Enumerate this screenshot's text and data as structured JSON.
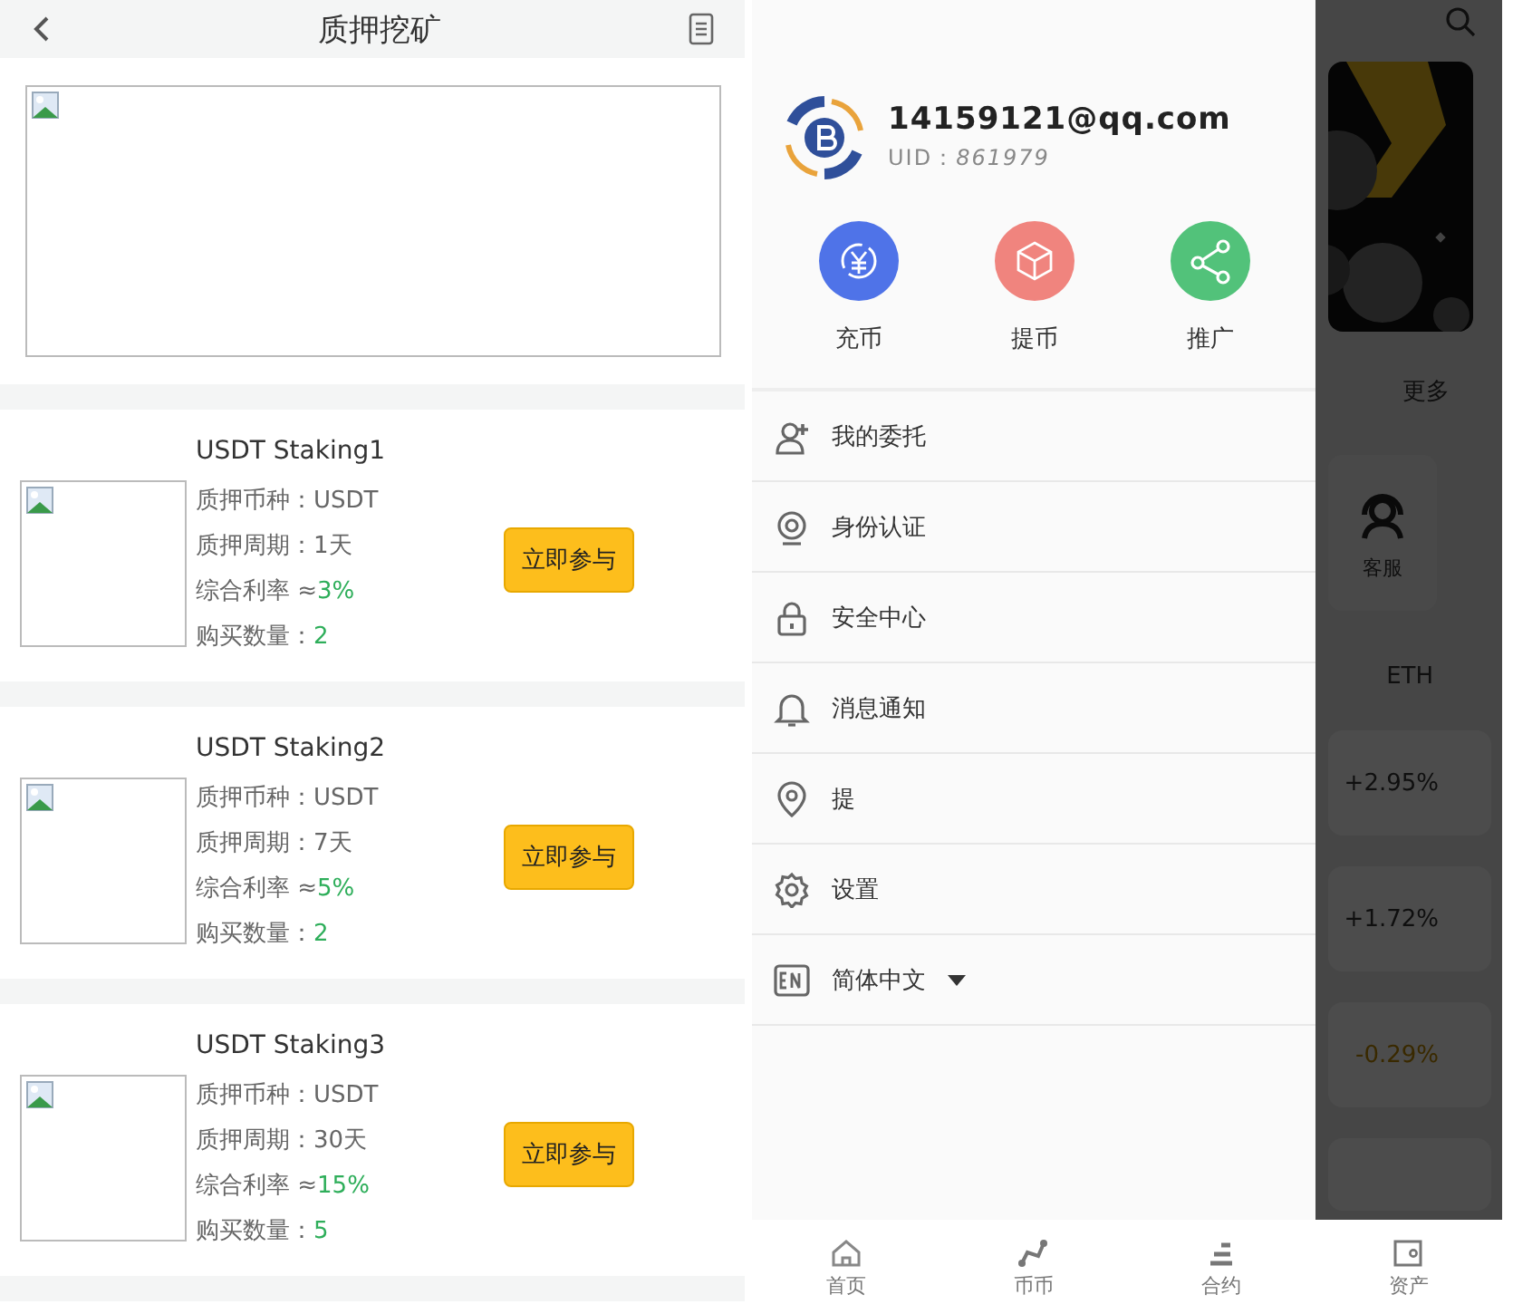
{
  "staking_page": {
    "title": "质押挖矿",
    "products": [
      {
        "name": "USDT Staking1",
        "rows": [
          {
            "label": "质押币种：",
            "value": "USDT",
            "kind": "plain"
          },
          {
            "label": "质押周期：",
            "value": "1天",
            "kind": "plain"
          },
          {
            "label": "综合利率 ≈",
            "value": "3%",
            "kind": "highlight"
          },
          {
            "label": "购买数量：",
            "value": "2",
            "kind": "highlight"
          }
        ],
        "button": "立即参与"
      },
      {
        "name": "USDT Staking2",
        "rows": [
          {
            "label": "质押币种：",
            "value": "USDT",
            "kind": "plain"
          },
          {
            "label": "质押周期：",
            "value": "7天",
            "kind": "plain"
          },
          {
            "label": "综合利率 ≈",
            "value": "5%",
            "kind": "highlight"
          },
          {
            "label": "购买数量：",
            "value": "2",
            "kind": "highlight"
          }
        ],
        "button": "立即参与"
      },
      {
        "name": "USDT Staking3",
        "rows": [
          {
            "label": "质押币种：",
            "value": "USDT",
            "kind": "plain"
          },
          {
            "label": "质押周期：",
            "value": "30天",
            "kind": "plain"
          },
          {
            "label": "综合利率 ≈",
            "value": "15%",
            "kind": "highlight"
          },
          {
            "label": "购买数量：",
            "value": "5",
            "kind": "highlight"
          }
        ],
        "button": "立即参与"
      }
    ]
  },
  "home_page": {
    "more": "更多",
    "service": "客服",
    "coin": "ETH",
    "changes": [
      {
        "value": "+2.95%",
        "kind": "up"
      },
      {
        "value": "+1.72%",
        "kind": "up"
      },
      {
        "value": "-0.29%",
        "kind": "down"
      }
    ]
  },
  "drawer": {
    "email": "14159121@qq.com",
    "uid_label": "UID：",
    "uid": "861979",
    "actions": [
      {
        "label": "充币",
        "kind": "deposit"
      },
      {
        "label": "提币",
        "kind": "withdraw"
      },
      {
        "label": "推广",
        "kind": "share"
      }
    ],
    "menu": [
      {
        "label": "我的委托",
        "kind": "orders"
      },
      {
        "label": "身份认证",
        "kind": "identity"
      },
      {
        "label": "安全中心",
        "kind": "security"
      },
      {
        "label": "消息通知",
        "kind": "notice"
      },
      {
        "label": "提",
        "kind": "address"
      },
      {
        "label": "设置",
        "kind": "settings"
      },
      {
        "label": "简体中文",
        "kind": "language"
      }
    ]
  },
  "tab_bar": [
    {
      "label": "首页",
      "kind": "home"
    },
    {
      "label": "币币",
      "kind": "spot"
    },
    {
      "label": "合约",
      "kind": "contract"
    },
    {
      "label": "资产",
      "kind": "assets"
    }
  ]
}
